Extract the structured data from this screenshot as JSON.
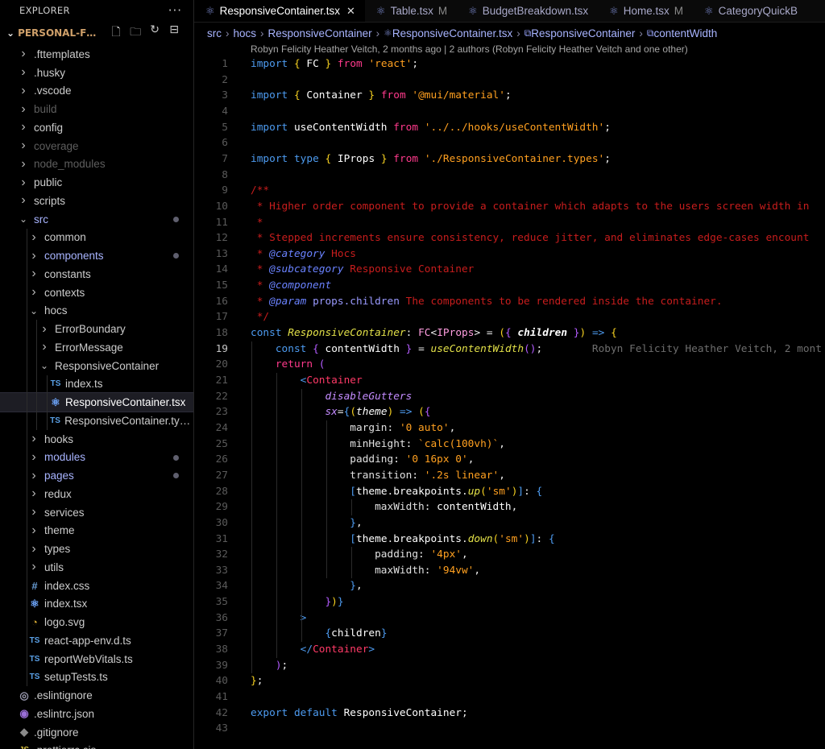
{
  "sidebar": {
    "title": "EXPLORER",
    "more": "···",
    "root": {
      "label": "PERSONAL-FINA..."
    },
    "items": [
      {
        "label": ".fttemplates",
        "depth": 0,
        "kind": "folder",
        "open": false,
        "color": "#cccccc"
      },
      {
        "label": ".husky",
        "depth": 0,
        "kind": "folder",
        "open": false,
        "color": "#cccccc"
      },
      {
        "label": ".vscode",
        "depth": 0,
        "kind": "folder",
        "open": false,
        "color": "#cccccc"
      },
      {
        "label": "build",
        "depth": 0,
        "kind": "folder",
        "open": false,
        "color": "#5e5e5e"
      },
      {
        "label": "config",
        "depth": 0,
        "kind": "folder",
        "open": false,
        "color": "#cccccc"
      },
      {
        "label": "coverage",
        "depth": 0,
        "kind": "folder",
        "open": false,
        "color": "#5e5e5e"
      },
      {
        "label": "node_modules",
        "depth": 0,
        "kind": "folder",
        "open": false,
        "color": "#5e5e5e"
      },
      {
        "label": "public",
        "depth": 0,
        "kind": "folder",
        "open": false,
        "color": "#cccccc"
      },
      {
        "label": "scripts",
        "depth": 0,
        "kind": "folder",
        "open": false,
        "color": "#cccccc"
      },
      {
        "label": "src",
        "depth": 0,
        "kind": "folder",
        "open": true,
        "color": "#a8b4ff",
        "dot": true
      },
      {
        "label": "common",
        "depth": 1,
        "kind": "folder",
        "open": false,
        "color": "#cccccc"
      },
      {
        "label": "components",
        "depth": 1,
        "kind": "folder",
        "open": false,
        "color": "#a8b4ff",
        "dot": true
      },
      {
        "label": "constants",
        "depth": 1,
        "kind": "folder",
        "open": false,
        "color": "#cccccc"
      },
      {
        "label": "contexts",
        "depth": 1,
        "kind": "folder",
        "open": false,
        "color": "#cccccc"
      },
      {
        "label": "hocs",
        "depth": 1,
        "kind": "folder",
        "open": true,
        "color": "#cccccc"
      },
      {
        "label": "ErrorBoundary",
        "depth": 2,
        "kind": "folder",
        "open": false,
        "color": "#cccccc"
      },
      {
        "label": "ErrorMessage",
        "depth": 2,
        "kind": "folder",
        "open": false,
        "color": "#cccccc"
      },
      {
        "label": "ResponsiveContainer",
        "depth": 2,
        "kind": "folder",
        "open": true,
        "color": "#cccccc"
      },
      {
        "label": "index.ts",
        "depth": 3,
        "kind": "ts",
        "color": "#cccccc"
      },
      {
        "label": "ResponsiveContainer.tsx",
        "depth": 3,
        "kind": "react",
        "color": "#ffffff",
        "selected": true
      },
      {
        "label": "ResponsiveContainer.type...",
        "depth": 3,
        "kind": "ts",
        "color": "#cccccc"
      },
      {
        "label": "hooks",
        "depth": 1,
        "kind": "folder",
        "open": false,
        "color": "#cccccc"
      },
      {
        "label": "modules",
        "depth": 1,
        "kind": "folder",
        "open": false,
        "color": "#a8b4ff",
        "dot": true
      },
      {
        "label": "pages",
        "depth": 1,
        "kind": "folder",
        "open": false,
        "color": "#a8b4ff",
        "dot": true
      },
      {
        "label": "redux",
        "depth": 1,
        "kind": "folder",
        "open": false,
        "color": "#cccccc"
      },
      {
        "label": "services",
        "depth": 1,
        "kind": "folder",
        "open": false,
        "color": "#cccccc"
      },
      {
        "label": "theme",
        "depth": 1,
        "kind": "folder",
        "open": false,
        "color": "#cccccc"
      },
      {
        "label": "types",
        "depth": 1,
        "kind": "folder",
        "open": false,
        "color": "#cccccc"
      },
      {
        "label": "utils",
        "depth": 1,
        "kind": "folder",
        "open": false,
        "color": "#cccccc"
      },
      {
        "label": "index.css",
        "depth": 1,
        "kind": "css",
        "color": "#cccccc"
      },
      {
        "label": "index.tsx",
        "depth": 1,
        "kind": "react",
        "color": "#cccccc"
      },
      {
        "label": "logo.svg",
        "depth": 1,
        "kind": "svg",
        "color": "#cccccc"
      },
      {
        "label": "react-app-env.d.ts",
        "depth": 1,
        "kind": "ts",
        "color": "#cccccc"
      },
      {
        "label": "reportWebVitals.ts",
        "depth": 1,
        "kind": "ts",
        "color": "#cccccc"
      },
      {
        "label": "setupTests.ts",
        "depth": 1,
        "kind": "ts",
        "color": "#cccccc"
      },
      {
        "label": ".eslintignore",
        "depth": 0,
        "kind": "eslint",
        "color": "#cccccc"
      },
      {
        "label": ".eslintrc.json",
        "depth": 0,
        "kind": "eslintrc",
        "color": "#cccccc"
      },
      {
        "label": ".gitignore",
        "depth": 0,
        "kind": "git",
        "color": "#cccccc"
      },
      {
        "label": ".prettierrc.cjs",
        "depth": 0,
        "kind": "js",
        "color": "#cccccc"
      }
    ]
  },
  "tabs": [
    {
      "label": "ResponsiveContainer.tsx",
      "active": true,
      "close": "✕",
      "mod": ""
    },
    {
      "label": "Table.tsx",
      "active": false,
      "mod": "M"
    },
    {
      "label": "BudgetBreakdown.tsx",
      "active": false,
      "mod": ""
    },
    {
      "label": "Home.tsx",
      "active": false,
      "mod": "M"
    },
    {
      "label": "CategoryQuickB",
      "active": false,
      "mod": ""
    }
  ],
  "breadcrumb": [
    "src",
    "hocs",
    "ResponsiveContainer",
    "ResponsiveContainer.tsx",
    "ResponsiveContainer",
    "contentWidth"
  ],
  "blame_header": "Robyn Felicity Heather Veitch, 2 months ago | 2 authors (Robyn Felicity Heather Veitch and one other)",
  "inline_blame": "Robyn Felicity Heather Veitch, 2 mont",
  "current_line": 19,
  "code": [
    [
      [
        "k",
        "import"
      ],
      [
        "p",
        " "
      ],
      [
        "br",
        "{"
      ],
      [
        "v",
        " FC "
      ],
      [
        "br",
        "}"
      ],
      [
        "kw",
        " from "
      ],
      [
        "s",
        "'react'"
      ],
      [
        "p",
        ";"
      ]
    ],
    [],
    [
      [
        "k",
        "import"
      ],
      [
        "p",
        " "
      ],
      [
        "br",
        "{"
      ],
      [
        "v",
        " Container "
      ],
      [
        "br",
        "}"
      ],
      [
        "kw",
        " from "
      ],
      [
        "s",
        "'@mui/material'"
      ],
      [
        "p",
        ";"
      ]
    ],
    [],
    [
      [
        "k",
        "import"
      ],
      [
        "v",
        " useContentWidth"
      ],
      [
        "kw",
        " from "
      ],
      [
        "s",
        "'../../hooks/useContentWidth'"
      ],
      [
        "p",
        ";"
      ]
    ],
    [],
    [
      [
        "k",
        "import"
      ],
      [
        "p",
        " "
      ],
      [
        "k",
        "type"
      ],
      [
        "p",
        " "
      ],
      [
        "br",
        "{"
      ],
      [
        "v",
        " IProps "
      ],
      [
        "br",
        "}"
      ],
      [
        "kw",
        " from "
      ],
      [
        "s",
        "'./ResponsiveContainer.types'"
      ],
      [
        "p",
        ";"
      ]
    ],
    [],
    [
      [
        "c",
        "/**"
      ]
    ],
    [
      [
        "c",
        " * Higher order component to provide a container which adapts to the users screen width in"
      ]
    ],
    [
      [
        "c",
        " *"
      ]
    ],
    [
      [
        "c",
        " * Stepped increments ensure consistency, reduce jitter, and eliminates edge-cases encount"
      ]
    ],
    [
      [
        "c",
        " * "
      ],
      [
        "ct",
        "@category"
      ],
      [
        "c",
        " Hocs"
      ]
    ],
    [
      [
        "c",
        " * "
      ],
      [
        "ct",
        "@subcategory"
      ],
      [
        "c",
        " Responsive Container"
      ]
    ],
    [
      [
        "c",
        " * "
      ],
      [
        "ct",
        "@component"
      ]
    ],
    [
      [
        "c",
        " * "
      ],
      [
        "ct",
        "@param"
      ],
      [
        "cn",
        " props.children"
      ],
      [
        "c",
        " The components to be rendered inside the container."
      ]
    ],
    [
      [
        "c",
        " */"
      ]
    ],
    [
      [
        "k",
        "const"
      ],
      [
        "p",
        " "
      ],
      [
        "f",
        "ResponsiveContainer"
      ],
      [
        "p",
        ": "
      ],
      [
        "ty",
        "FC"
      ],
      [
        "p",
        "<"
      ],
      [
        "ty",
        "IProps"
      ],
      [
        "p",
        "> = "
      ],
      [
        "br",
        "("
      ],
      [
        "b2",
        "{"
      ],
      [
        "p",
        " "
      ],
      [
        "v",
        "children"
      ],
      [
        "p",
        " "
      ],
      [
        "b2",
        "}"
      ],
      [
        "br",
        ")"
      ],
      [
        "p",
        " "
      ],
      [
        "k",
        "=>"
      ],
      [
        "p",
        " "
      ],
      [
        "br",
        "{"
      ]
    ],
    [
      [
        "p",
        "    "
      ],
      [
        "k",
        "const"
      ],
      [
        "p",
        " "
      ],
      [
        "b2",
        "{"
      ],
      [
        "v",
        " contentWidth "
      ],
      [
        "b2",
        "}"
      ],
      [
        "p",
        " = "
      ],
      [
        "f",
        "useContentWidth"
      ],
      [
        "b2",
        "()"
      ],
      [
        "p",
        ";"
      ]
    ],
    [
      [
        "p",
        "    "
      ],
      [
        "kw",
        "return"
      ],
      [
        "p",
        " "
      ],
      [
        "b2",
        "("
      ]
    ],
    [
      [
        "p",
        "        "
      ],
      [
        "b3",
        "<"
      ],
      [
        "tg",
        "Container"
      ]
    ],
    [
      [
        "p",
        "            "
      ],
      [
        "at",
        "disableGutters"
      ]
    ],
    [
      [
        "p",
        "            "
      ],
      [
        "at",
        "sx"
      ],
      [
        "p",
        "="
      ],
      [
        "b3",
        "{"
      ],
      [
        "br",
        "("
      ],
      [
        "v",
        "theme"
      ],
      [
        "br",
        ")"
      ],
      [
        "p",
        " "
      ],
      [
        "k",
        "=>"
      ],
      [
        "p",
        " "
      ],
      [
        "br",
        "("
      ],
      [
        "b2",
        "{"
      ]
    ],
    [
      [
        "p",
        "                "
      ],
      [
        "pr",
        "margin"
      ],
      [
        "p",
        ": "
      ],
      [
        "s",
        "'0 auto'"
      ],
      [
        "p",
        ","
      ]
    ],
    [
      [
        "p",
        "                "
      ],
      [
        "pr",
        "minHeight"
      ],
      [
        "p",
        ": "
      ],
      [
        "s",
        "`calc(100vh)`"
      ],
      [
        "p",
        ","
      ]
    ],
    [
      [
        "p",
        "                "
      ],
      [
        "pr",
        "padding"
      ],
      [
        "p",
        ": "
      ],
      [
        "s",
        "'0 16px 0'"
      ],
      [
        "p",
        ","
      ]
    ],
    [
      [
        "p",
        "                "
      ],
      [
        "pr",
        "transition"
      ],
      [
        "p",
        ": "
      ],
      [
        "s",
        "'.2s linear'"
      ],
      [
        "p",
        ","
      ]
    ],
    [
      [
        "p",
        "                "
      ],
      [
        "b3",
        "["
      ],
      [
        "v",
        "theme"
      ],
      [
        "p",
        "."
      ],
      [
        "v",
        "breakpoints"
      ],
      [
        "p",
        "."
      ],
      [
        "f",
        "up"
      ],
      [
        "br",
        "("
      ],
      [
        "s",
        "'sm'"
      ],
      [
        "br",
        ")"
      ],
      [
        "b3",
        "]"
      ],
      [
        "p",
        ": "
      ],
      [
        "b3",
        "{"
      ]
    ],
    [
      [
        "p",
        "                    "
      ],
      [
        "pr",
        "maxWidth"
      ],
      [
        "p",
        ": "
      ],
      [
        "v",
        "contentWidth"
      ],
      [
        "p",
        ","
      ]
    ],
    [
      [
        "p",
        "                "
      ],
      [
        "b3",
        "}"
      ],
      [
        "p",
        ","
      ]
    ],
    [
      [
        "p",
        "                "
      ],
      [
        "b3",
        "["
      ],
      [
        "v",
        "theme"
      ],
      [
        "p",
        "."
      ],
      [
        "v",
        "breakpoints"
      ],
      [
        "p",
        "."
      ],
      [
        "f",
        "down"
      ],
      [
        "br",
        "("
      ],
      [
        "s",
        "'sm'"
      ],
      [
        "br",
        ")"
      ],
      [
        "b3",
        "]"
      ],
      [
        "p",
        ": "
      ],
      [
        "b3",
        "{"
      ]
    ],
    [
      [
        "p",
        "                    "
      ],
      [
        "pr",
        "padding"
      ],
      [
        "p",
        ": "
      ],
      [
        "s",
        "'4px'"
      ],
      [
        "p",
        ","
      ]
    ],
    [
      [
        "p",
        "                    "
      ],
      [
        "pr",
        "maxWidth"
      ],
      [
        "p",
        ": "
      ],
      [
        "s",
        "'94vw'"
      ],
      [
        "p",
        ","
      ]
    ],
    [
      [
        "p",
        "                "
      ],
      [
        "b3",
        "}"
      ],
      [
        "p",
        ","
      ]
    ],
    [
      [
        "p",
        "            "
      ],
      [
        "b2",
        "}"
      ],
      [
        "br",
        ")"
      ],
      [
        "b3",
        "}"
      ]
    ],
    [
      [
        "p",
        "        "
      ],
      [
        "b3",
        ">"
      ]
    ],
    [
      [
        "p",
        "            "
      ],
      [
        "b3",
        "{"
      ],
      [
        "v",
        "children"
      ],
      [
        "b3",
        "}"
      ]
    ],
    [
      [
        "p",
        "        "
      ],
      [
        "b3",
        "</"
      ],
      [
        "tg",
        "Container"
      ],
      [
        "b3",
        ">"
      ]
    ],
    [
      [
        "p",
        "    "
      ],
      [
        "b2",
        ")"
      ],
      [
        "p",
        ";"
      ]
    ],
    [
      [
        "br",
        "}"
      ],
      [
        "p",
        ";"
      ]
    ],
    [],
    [
      [
        "k",
        "export"
      ],
      [
        "p",
        " "
      ],
      [
        "k",
        "default"
      ],
      [
        "v",
        " ResponsiveContainer"
      ],
      [
        "p",
        ";"
      ]
    ],
    []
  ],
  "colors": {
    "k": "#4d9bf0",
    "kw": "#ff3a8c",
    "s": "#ffa020",
    "c": "#c81d1d",
    "accent": "#a8b4ff"
  }
}
